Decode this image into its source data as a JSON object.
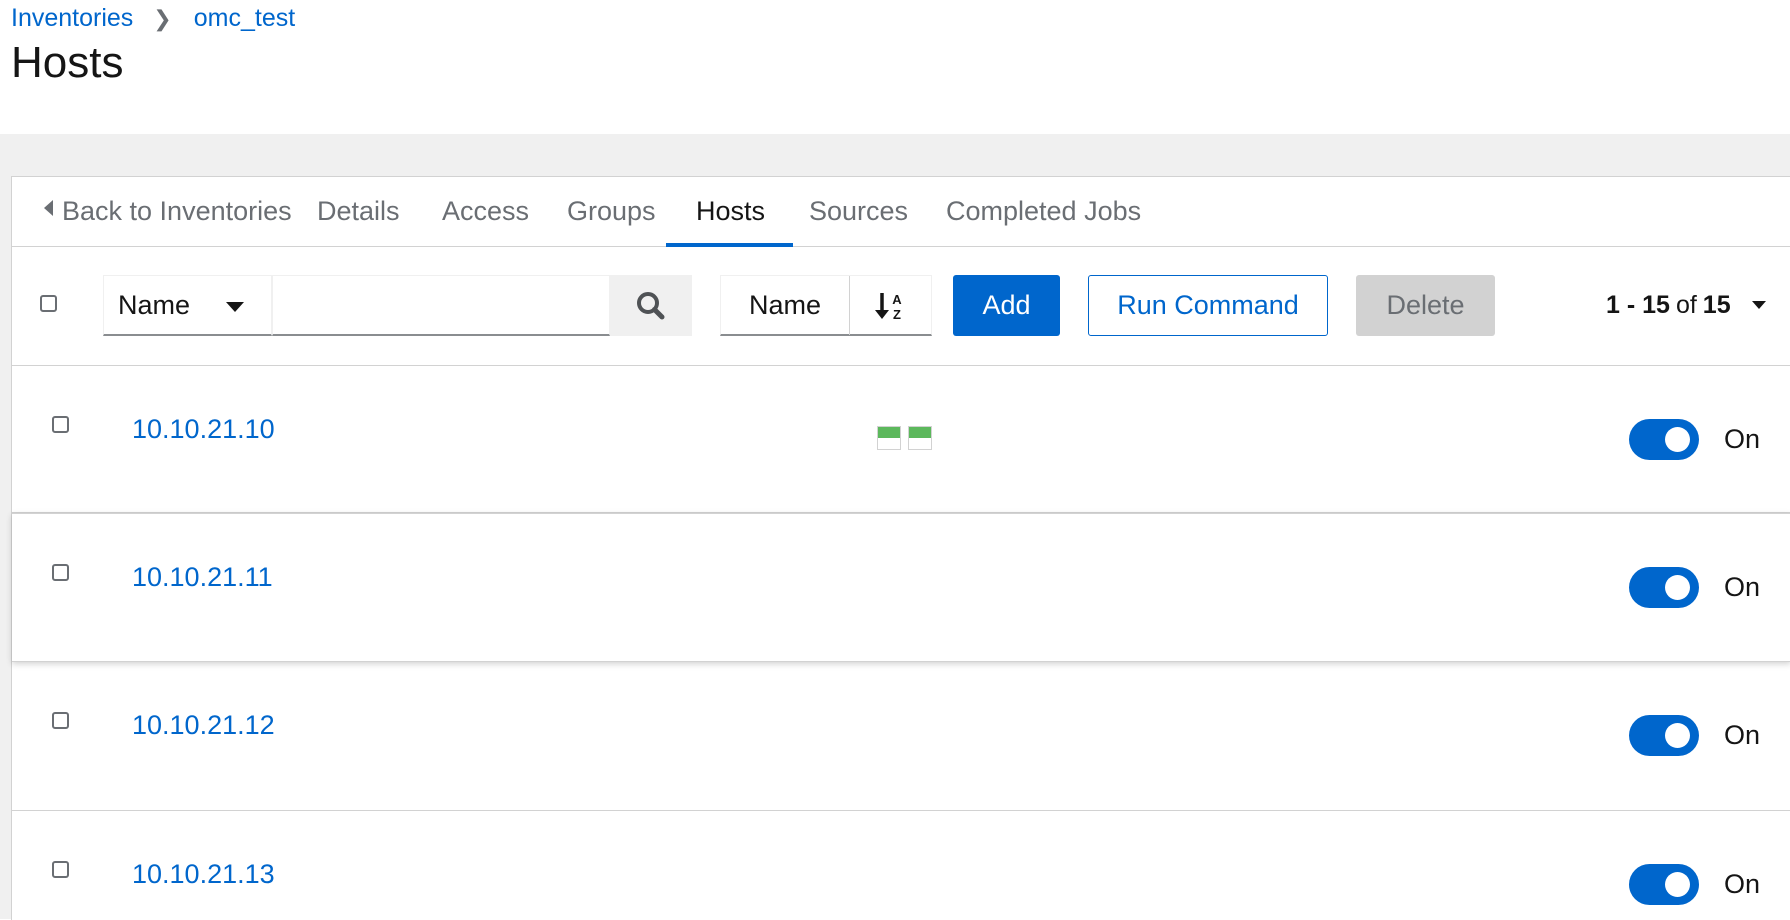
{
  "breadcrumb": {
    "items": [
      "Inventories",
      "omc_test"
    ]
  },
  "page": {
    "title": "Hosts"
  },
  "tabs": [
    {
      "label": "Back to Inventories",
      "active": false
    },
    {
      "label": "Details",
      "active": false
    },
    {
      "label": "Access",
      "active": false
    },
    {
      "label": "Groups",
      "active": false
    },
    {
      "label": "Hosts",
      "active": true
    },
    {
      "label": "Sources",
      "active": false
    },
    {
      "label": "Completed Jobs",
      "active": false
    }
  ],
  "toolbar": {
    "filter_field": "Name",
    "search_value": "",
    "sort_field": "Name",
    "add_label": "Add",
    "run_command_label": "Run Command",
    "delete_label": "Delete",
    "pagination": {
      "range": "1 - 15",
      "of": "of",
      "total": "15"
    }
  },
  "hosts": [
    {
      "name": "10.10.21.10",
      "recent_jobs": [
        "success",
        "success"
      ],
      "enabled_label": "On"
    },
    {
      "name": "10.10.21.11",
      "recent_jobs": [],
      "enabled_label": "On"
    },
    {
      "name": "10.10.21.12",
      "recent_jobs": [],
      "enabled_label": "On"
    },
    {
      "name": "10.10.21.13",
      "recent_jobs": [],
      "enabled_label": "On"
    }
  ],
  "colors": {
    "primary": "#0066cc",
    "success": "#5cb85c",
    "disabled": "#d2d2d2",
    "page_background": "#f0f0f0"
  }
}
